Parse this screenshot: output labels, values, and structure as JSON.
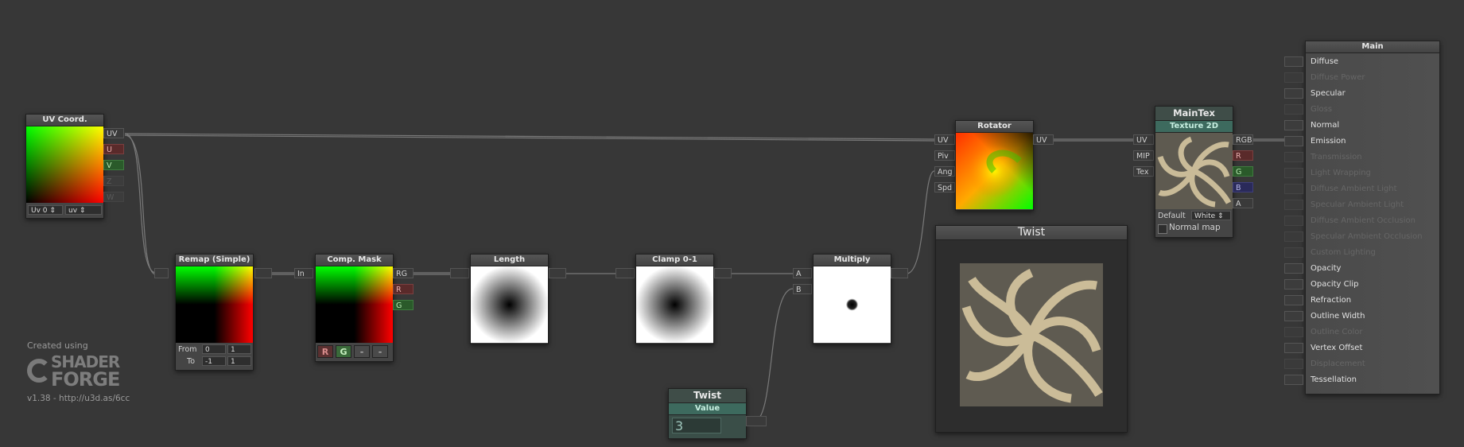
{
  "canvas": {
    "background": "#373737"
  },
  "uv_coord": {
    "title": "UV Coord.",
    "outputs": [
      "UV",
      "U",
      "V",
      "Z",
      "W"
    ],
    "channel_dropdown": "Uv 0",
    "mode_dropdown": "uv"
  },
  "remap": {
    "title": "Remap (Simple)",
    "from_label": "From",
    "from_min": "0",
    "from_max": "1",
    "to_label": "To",
    "to_min": "-1",
    "to_max": "1"
  },
  "comp_mask": {
    "title": "Comp. Mask",
    "input": "In",
    "outputs": [
      "RG",
      "R",
      "G"
    ],
    "channels": [
      "R",
      "G",
      "-",
      "-"
    ]
  },
  "length": {
    "title": "Length"
  },
  "clamp": {
    "title": "Clamp 0-1"
  },
  "multiply": {
    "title": "Multiply",
    "inputs": [
      "A",
      "B"
    ]
  },
  "rotator": {
    "title": "Rotator",
    "inputs": [
      "UV",
      "Piv",
      "Ang",
      "Spd"
    ],
    "output": "UV"
  },
  "maintex": {
    "name": "MainTex",
    "title": "Texture 2D",
    "inputs": [
      "UV",
      "MIP",
      "Tex"
    ],
    "outputs": [
      "RGB",
      "R",
      "G",
      "B",
      "A"
    ],
    "default_label": "Default",
    "default_value": "White",
    "normal_map_label": "Normal map"
  },
  "twist_value": {
    "name": "Twist",
    "title": "Value",
    "value": "3"
  },
  "twist_preview": {
    "title": "Twist"
  },
  "main": {
    "title": "Main",
    "inputs": [
      {
        "label": "Diffuse",
        "active": true
      },
      {
        "label": "Diffuse Power",
        "active": false
      },
      {
        "label": "Specular",
        "active": true
      },
      {
        "label": "Gloss",
        "active": false
      },
      {
        "label": "Normal",
        "active": true
      },
      {
        "label": "Emission",
        "active": true
      },
      {
        "label": "Transmission",
        "active": false
      },
      {
        "label": "Light Wrapping",
        "active": false
      },
      {
        "label": "Diffuse Ambient Light",
        "active": false
      },
      {
        "label": "Specular Ambient Light",
        "active": false
      },
      {
        "label": "Diffuse Ambient Occlusion",
        "active": false
      },
      {
        "label": "Specular Ambient Occlusion",
        "active": false
      },
      {
        "label": "Custom Lighting",
        "active": false
      },
      {
        "label": "Opacity",
        "active": true
      },
      {
        "label": "Opacity Clip",
        "active": true
      },
      {
        "label": "Refraction",
        "active": true
      },
      {
        "label": "Outline Width",
        "active": true
      },
      {
        "label": "Outline Color",
        "active": false
      },
      {
        "label": "Vertex Offset",
        "active": true
      },
      {
        "label": "Displacement",
        "active": false
      },
      {
        "label": "Tessellation",
        "active": true
      }
    ]
  },
  "watermark": {
    "created": "Created using",
    "brand_line1": "SHADER",
    "brand_line2": "FORGE",
    "version": "v1.38 - http://u3d.as/6cc"
  }
}
